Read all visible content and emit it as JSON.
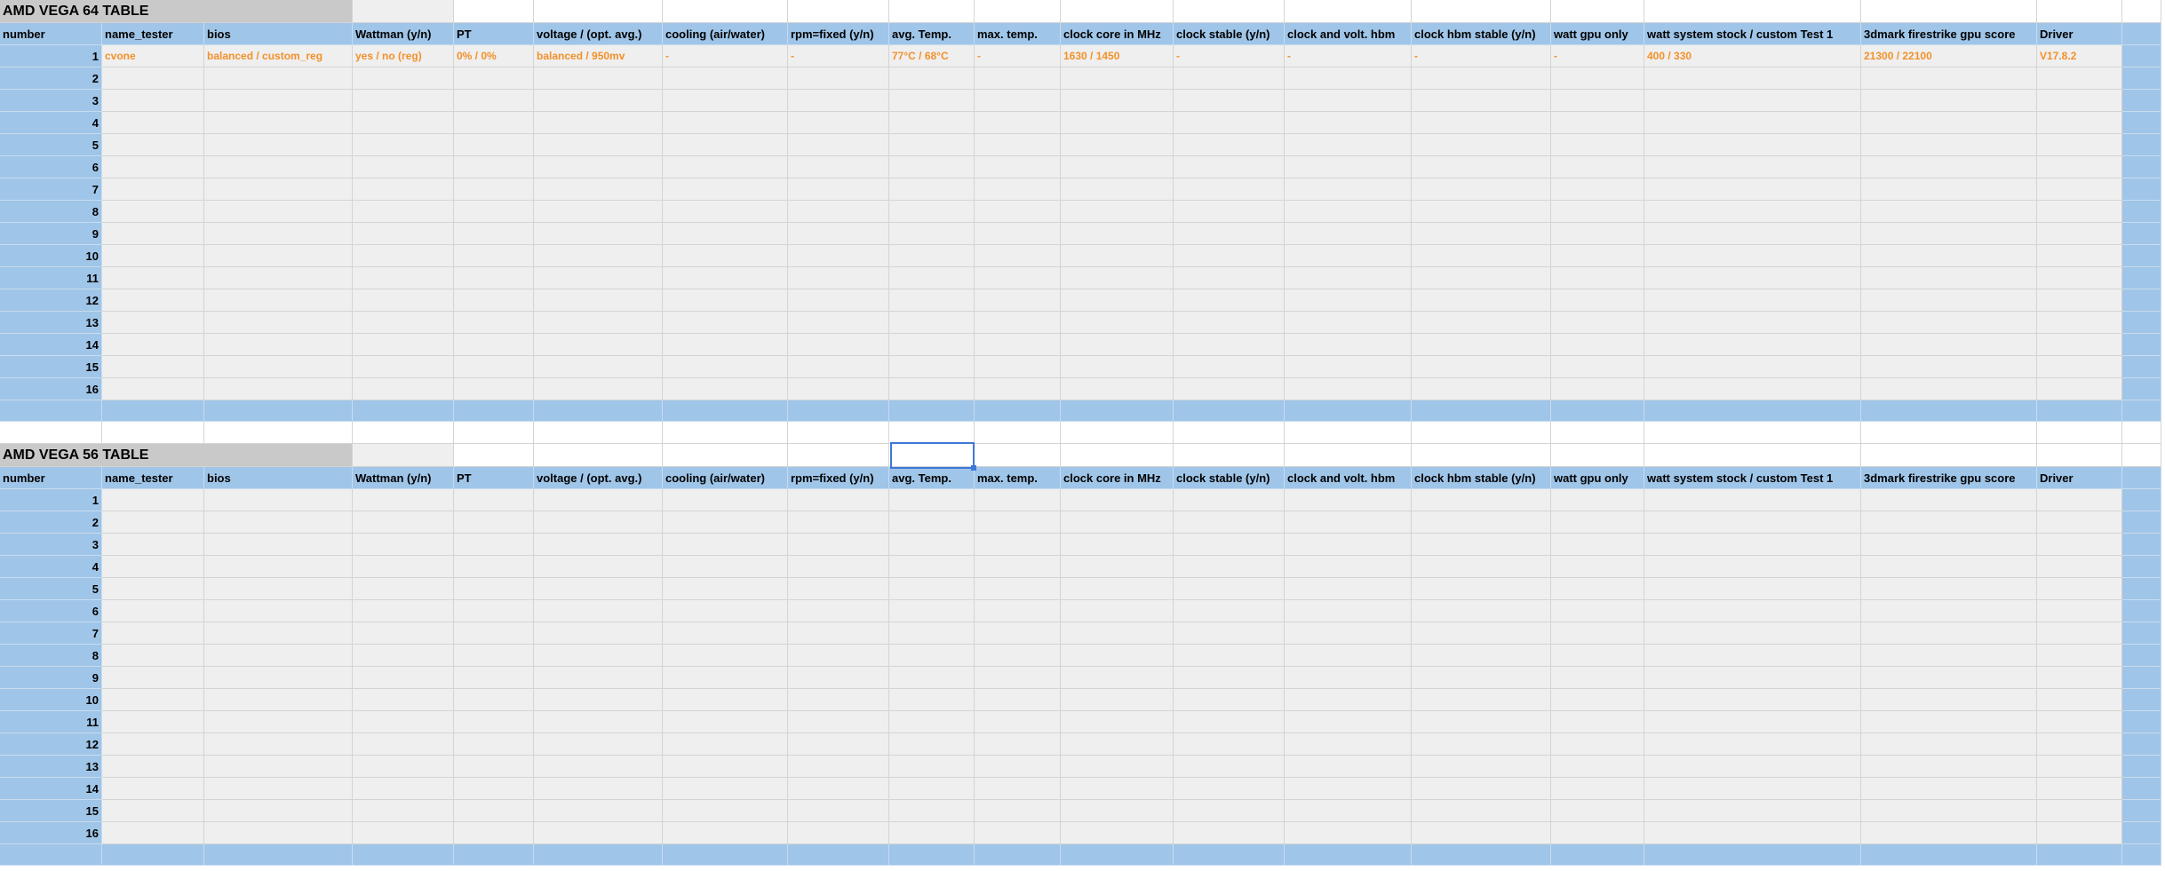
{
  "columns": [
    "number",
    "name_tester",
    "bios",
    "Wattman (y/n)",
    "PT",
    "voltage / (opt. avg.)",
    "cooling (air/water)",
    "rpm=fixed (y/n)",
    "avg. Temp.",
    "max. temp.",
    "clock core in MHz",
    "clock stable (y/n)",
    "clock and volt. hbm",
    "clock hbm stable (y/n)",
    "watt gpu only",
    "watt system stock / custom Test 1",
    "3dmark firestrike gpu score",
    "Driver"
  ],
  "tables": [
    {
      "title": "AMD VEGA 64 TABLE",
      "rows": [
        [
          "1",
          "cvone",
          "balanced / custom_reg",
          "yes / no (reg)",
          "0% / 0%",
          "balanced / 950mv",
          "-",
          "-",
          "77°C / 68°C",
          "-",
          "1630 / 1450",
          "-",
          "-",
          "-",
          "-",
          "400 / 330",
          "21300 / 22100",
          "V17.8.2"
        ],
        [
          "2"
        ],
        [
          "3"
        ],
        [
          "4"
        ],
        [
          "5"
        ],
        [
          "6"
        ],
        [
          "7"
        ],
        [
          "8"
        ],
        [
          "9"
        ],
        [
          "10"
        ],
        [
          "11"
        ],
        [
          "12"
        ],
        [
          "13"
        ],
        [
          "14"
        ],
        [
          "15"
        ],
        [
          "16"
        ]
      ]
    },
    {
      "title": "AMD VEGA 56 TABLE",
      "rows": [
        [
          "1"
        ],
        [
          "2"
        ],
        [
          "3"
        ],
        [
          "4"
        ],
        [
          "5"
        ],
        [
          "6"
        ],
        [
          "7"
        ],
        [
          "8"
        ],
        [
          "9"
        ],
        [
          "10"
        ],
        [
          "11"
        ],
        [
          "12"
        ],
        [
          "13"
        ],
        [
          "14"
        ],
        [
          "15"
        ],
        [
          "16"
        ]
      ]
    }
  ],
  "colors": {
    "header_blue": "#9fc5e8",
    "title_gray": "#c9c9c9",
    "cell_gray": "#efefef",
    "entry_orange": "#f2912a",
    "selection_blue": "#3c78d8"
  }
}
